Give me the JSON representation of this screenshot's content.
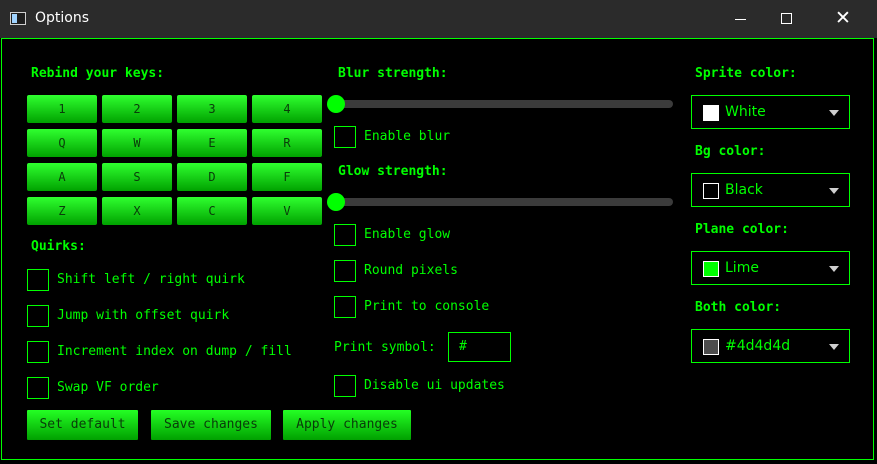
{
  "window": {
    "title": "Options",
    "close_glyph": "✕"
  },
  "keys": {
    "heading": "Rebind your keys:",
    "rows": [
      [
        "1",
        "2",
        "3",
        "4"
      ],
      [
        "Q",
        "W",
        "E",
        "R"
      ],
      [
        "A",
        "S",
        "D",
        "F"
      ],
      [
        "Z",
        "X",
        "C",
        "V"
      ]
    ]
  },
  "quirks": {
    "heading": "Quirks:",
    "items": [
      {
        "label": "Shift left / right quirk",
        "checked": false
      },
      {
        "label": "Jump with offset quirk",
        "checked": false
      },
      {
        "label": "Increment index on dump / fill",
        "checked": false
      },
      {
        "label": "Swap VF order",
        "checked": false
      }
    ]
  },
  "actions": {
    "set_default": "Set default",
    "save": "Save changes",
    "apply": "Apply changes"
  },
  "blur": {
    "heading": "Blur strength:",
    "value": 0,
    "enable_label": "Enable blur",
    "enabled": false
  },
  "glow": {
    "heading": "Glow strength:",
    "value": 0,
    "enable_label": "Enable glow",
    "enabled": false
  },
  "options": [
    {
      "label": "Round pixels",
      "checked": false
    },
    {
      "label": "Print to console",
      "checked": false
    }
  ],
  "print_symbol": {
    "label": "Print symbol:",
    "value": "#"
  },
  "disable_ui": {
    "label": "Disable ui updates",
    "checked": false
  },
  "colors": {
    "sprite": {
      "heading": "Sprite color:",
      "value": "White",
      "swatch": "#ffffff"
    },
    "bg": {
      "heading": "Bg color:",
      "value": "Black",
      "swatch": "#000000"
    },
    "plane": {
      "heading": "Plane color:",
      "value": "Lime",
      "swatch": "#00ff00"
    },
    "both": {
      "heading": "Both color:",
      "value": "#4d4d4d",
      "swatch": "#4d4d4d"
    }
  },
  "theme": {
    "accent": "#00ff00",
    "background": "#000000",
    "titlebar": "#2b2b2b"
  }
}
